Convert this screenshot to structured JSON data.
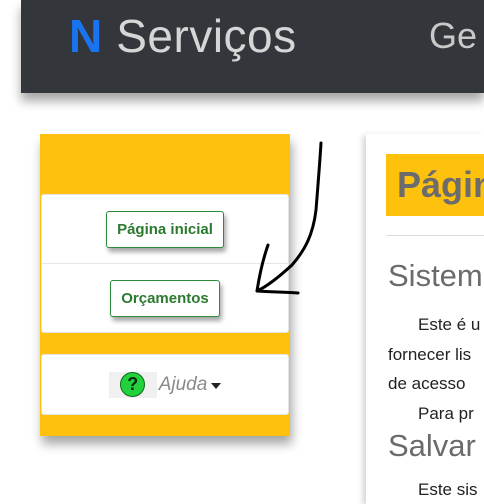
{
  "header": {
    "brand_letter": "N",
    "brand_name": "Serviços",
    "nav_partial": "Ge"
  },
  "sidebar": {
    "items": [
      {
        "label": "Página inicial"
      },
      {
        "label": "Orçamentos"
      }
    ],
    "help": {
      "icon_glyph": "?",
      "label": "Ajuda"
    }
  },
  "main": {
    "title": "Págin",
    "section1_title": "Sistem",
    "paragraph_lines": [
      "Este é u",
      "fornecer lis",
      "de acesso",
      "Para pr"
    ],
    "section2_title": "Salvar c",
    "last_line": "Este sis"
  },
  "colors": {
    "accent": "#fec10e",
    "header_bg": "#33363b",
    "brand_letter": "#1a73f0",
    "button_text": "#2c7a2f",
    "help_icon": "#22d13c"
  }
}
